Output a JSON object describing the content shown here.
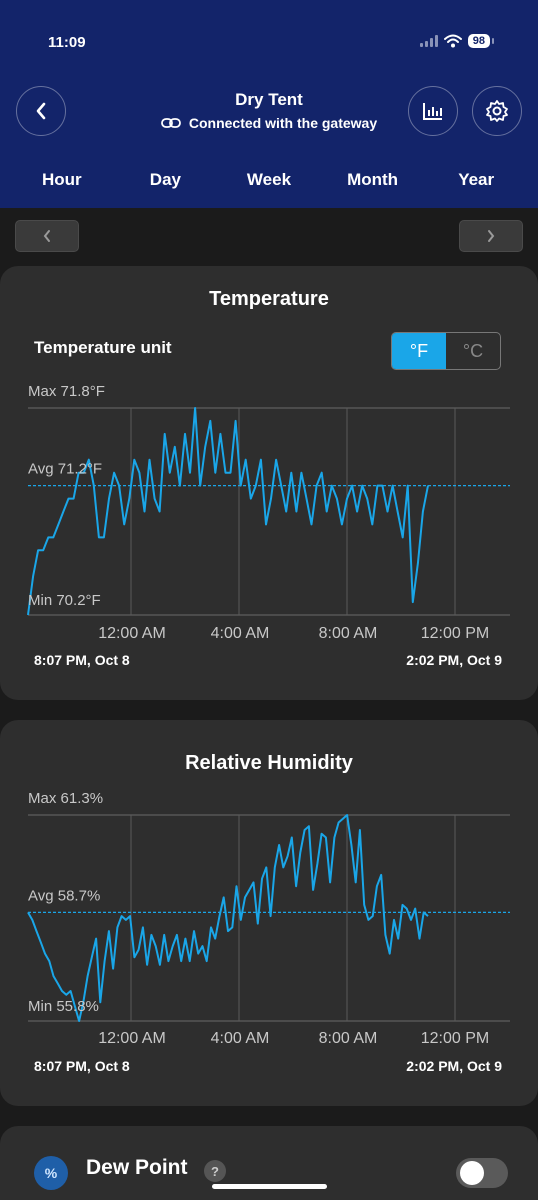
{
  "status": {
    "time": "11:09",
    "battery": "98"
  },
  "header": {
    "title": "Dry Tent",
    "subtitle": "Connected with the gateway",
    "tabs": [
      "Hour",
      "Day",
      "Week",
      "Month",
      "Year"
    ]
  },
  "temperature": {
    "title": "Temperature",
    "unit_label": "Temperature unit",
    "unit_options": [
      "°F",
      "°C"
    ],
    "selected_unit": "°F",
    "max_label": "Max 71.8°F",
    "avg_label": "Avg 71.2°F",
    "min_label": "Min 70.2°F",
    "x_ticks": [
      "12:00 AM",
      "4:00 AM",
      "8:00 AM",
      "12:00 PM"
    ],
    "start_label": "8:07 PM, Oct 8",
    "end_label": "2:02 PM, Oct 9"
  },
  "humidity": {
    "title": "Relative Humidity",
    "max_label": "Max 61.3%",
    "avg_label": "Avg 58.7%",
    "min_label": "Min 55.8%",
    "x_ticks": [
      "12:00 AM",
      "4:00 AM",
      "8:00 AM",
      "12:00 PM"
    ],
    "start_label": "8:07 PM, Oct 8",
    "end_label": "2:02 PM, Oct 9"
  },
  "dew_point": {
    "title": "Dew Point",
    "icon_text": "%",
    "help": "?"
  },
  "colors": {
    "header_bg": "#13246a",
    "accent": "#1aa6e8",
    "card_bg": "#2e2e2e",
    "page_bg": "#1b1b1b"
  },
  "icons": [
    "back-arrow-icon",
    "link-icon",
    "bar-chart-icon",
    "gear-icon",
    "chevron-left-icon",
    "chevron-right-icon",
    "help-icon",
    "dew-point-icon"
  ],
  "chart_data": [
    {
      "type": "line",
      "title": "Temperature",
      "ylim": [
        70.2,
        71.8
      ],
      "avg": 71.2,
      "x_ticks": [
        "12:00 AM",
        "4:00 AM",
        "8:00 AM",
        "12:00 PM"
      ],
      "series": [
        {
          "values": [
            70.2,
            70.5,
            70.7,
            70.7,
            70.8,
            70.8,
            70.9,
            71.0,
            71.1,
            71.1,
            71.3,
            71.3,
            71.4,
            71.2,
            70.8,
            70.8,
            71.1,
            71.3,
            71.2,
            70.9,
            71.1,
            71.4,
            71.3,
            71.0,
            71.4,
            71.1,
            71.0,
            71.6,
            71.3,
            71.5,
            71.2,
            71.6,
            71.3,
            71.8,
            71.2,
            71.5,
            71.7,
            71.3,
            71.6,
            71.3,
            71.3,
            71.7,
            71.2,
            71.4,
            71.1,
            71.2,
            71.4,
            70.9,
            71.1,
            71.4,
            71.2,
            71.0,
            71.3,
            71.0,
            71.3,
            71.1,
            70.9,
            71.2,
            71.3,
            71.0,
            71.2,
            71.1,
            70.9,
            71.1,
            71.2,
            71.0,
            71.2,
            71.1,
            70.9,
            71.2,
            71.2,
            71.0,
            71.2,
            71.0,
            70.8,
            71.2,
            70.3,
            70.6,
            71.0,
            71.2
          ]
        }
      ]
    },
    {
      "type": "line",
      "title": "Relative Humidity",
      "ylim": [
        55.8,
        61.3
      ],
      "avg": 58.7,
      "x_ticks": [
        "12:00 AM",
        "4:00 AM",
        "8:00 AM",
        "12:00 PM"
      ],
      "series": [
        {
          "values": [
            58.7,
            58.5,
            58.2,
            57.9,
            57.6,
            57.4,
            57.0,
            56.8,
            56.6,
            56.5,
            56.6,
            56.2,
            55.8,
            56.3,
            57.0,
            57.5,
            58.0,
            56.3,
            57.4,
            58.2,
            57.2,
            58.3,
            58.6,
            58.5,
            58.6,
            57.5,
            57.7,
            58.3,
            57.3,
            58.1,
            57.8,
            57.3,
            58.1,
            57.4,
            57.8,
            58.1,
            57.4,
            58.0,
            57.4,
            58.2,
            57.6,
            57.8,
            57.4,
            58.3,
            58.0,
            58.6,
            59.1,
            58.2,
            58.3,
            59.4,
            58.5,
            59.1,
            59.3,
            59.5,
            58.4,
            59.6,
            59.9,
            58.6,
            59.9,
            60.5,
            59.9,
            60.2,
            60.7,
            59.4,
            60.3,
            60.9,
            61.0,
            59.3,
            60.0,
            60.8,
            60.7,
            59.5,
            60.7,
            61.1,
            61.2,
            61.3,
            60.5,
            59.5,
            60.9,
            58.9,
            58.5,
            58.6,
            59.4,
            59.7,
            58.1,
            57.6,
            58.5,
            58.0,
            58.9,
            58.8,
            58.5,
            58.8,
            58.0,
            58.7,
            58.6
          ]
        }
      ]
    }
  ]
}
